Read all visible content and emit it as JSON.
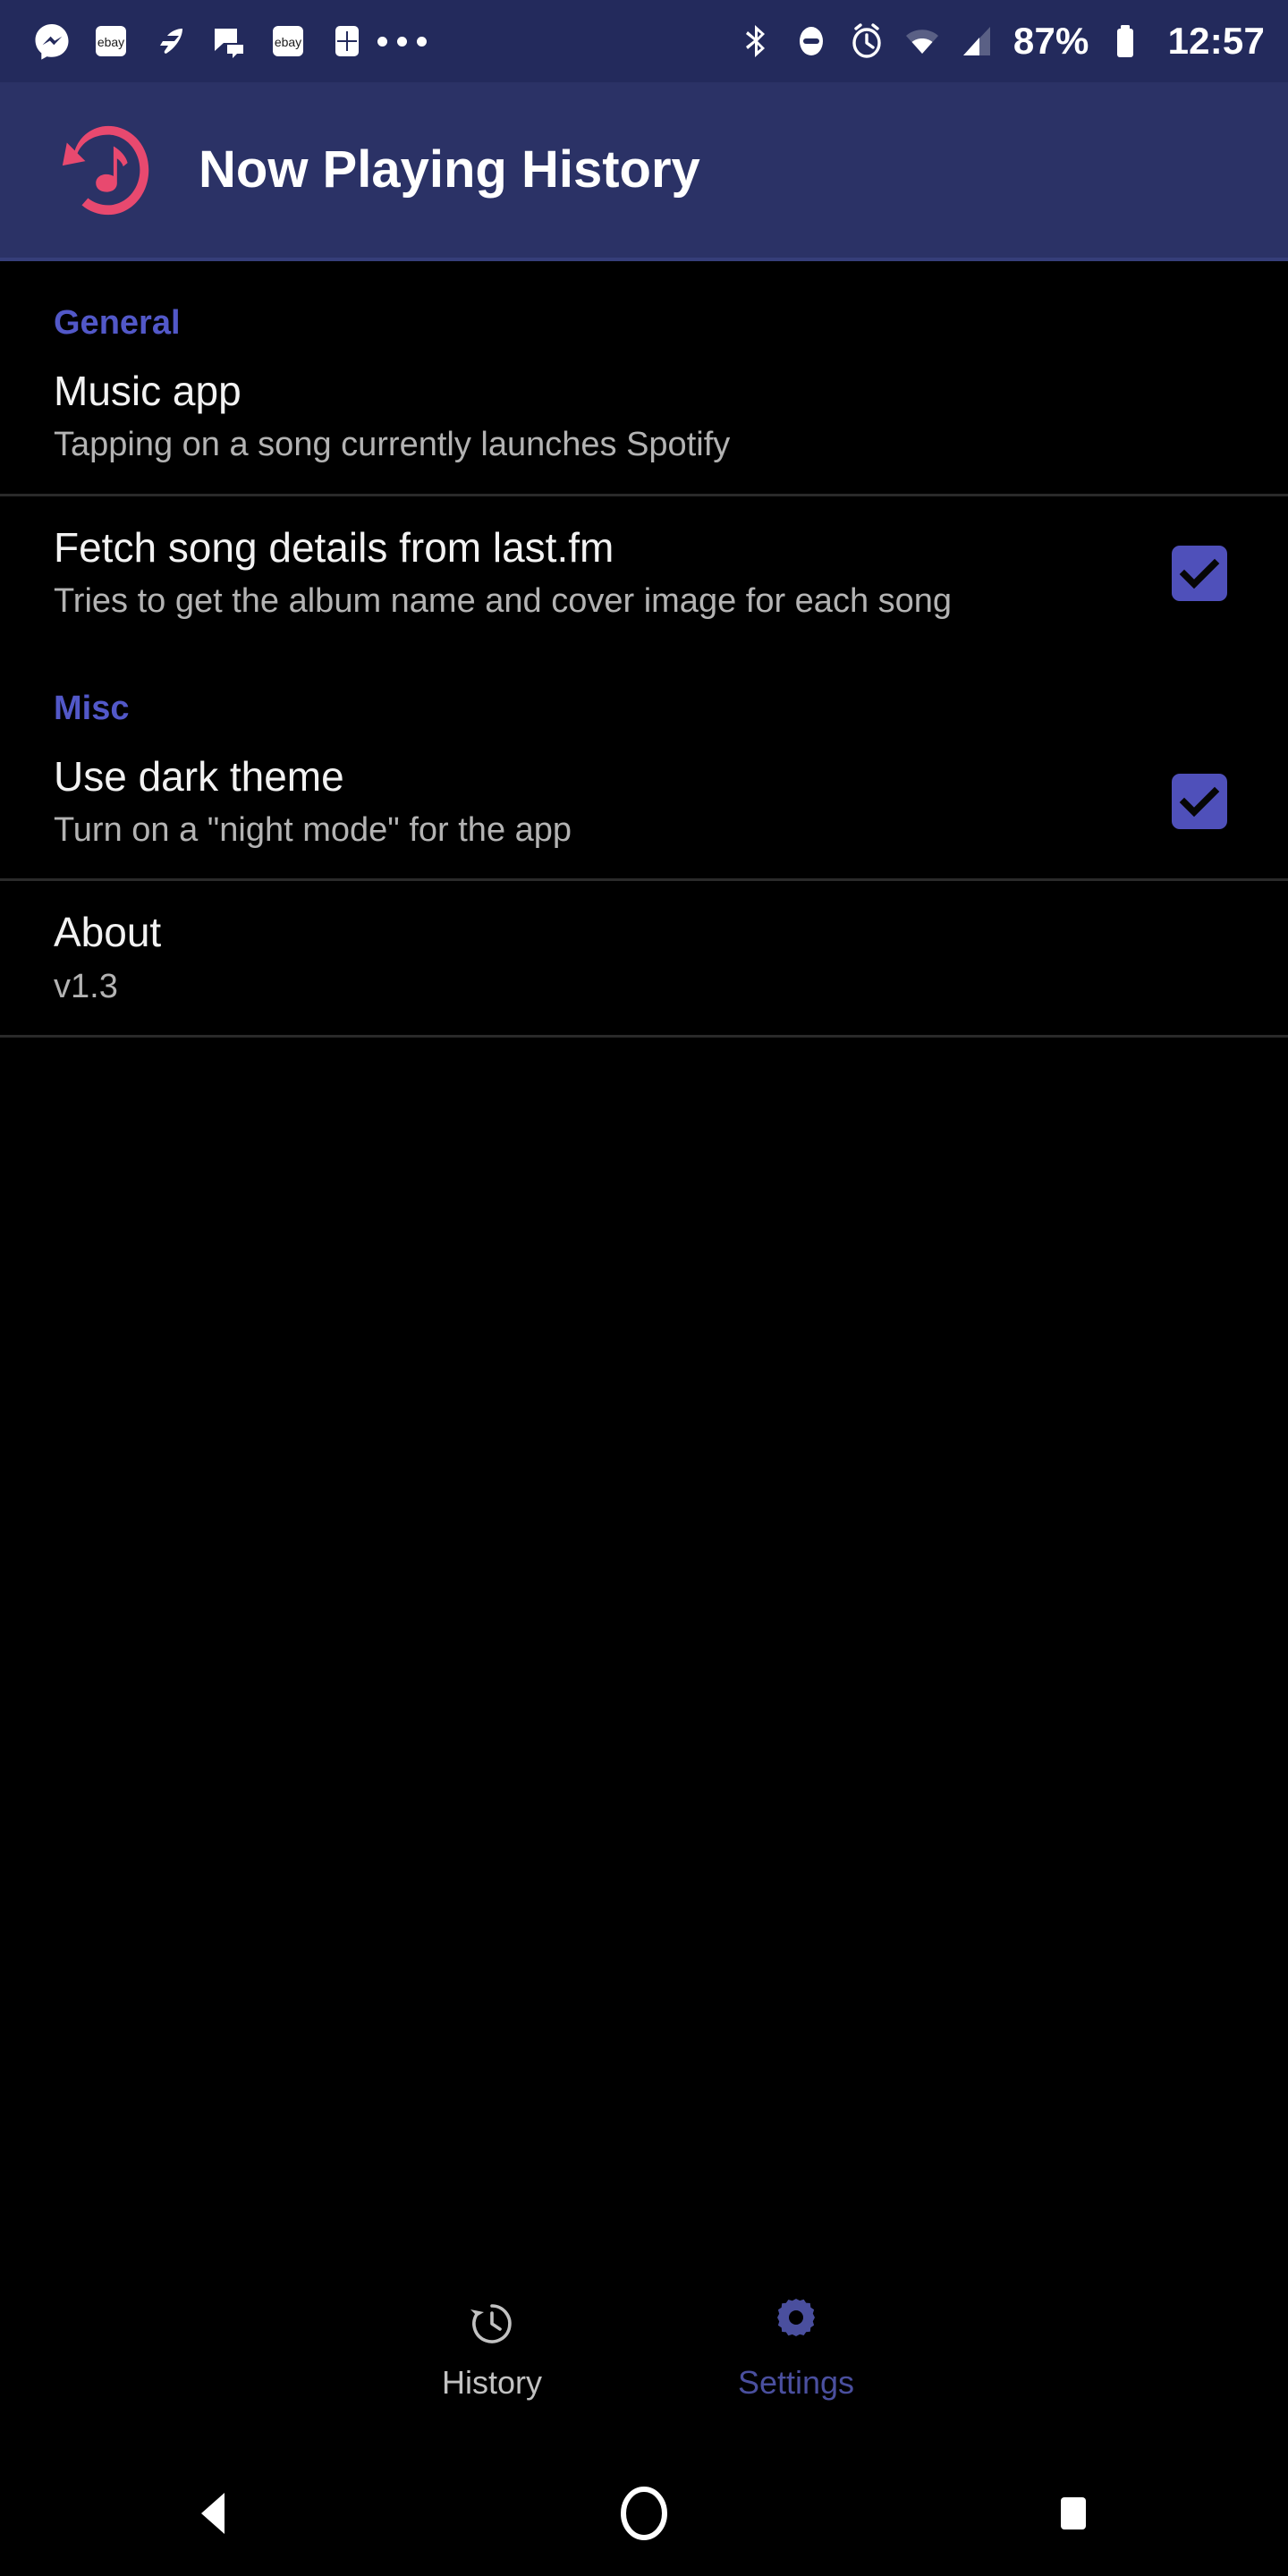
{
  "status_bar": {
    "notification_icons": [
      {
        "name": "messenger-icon",
        "label": "Messenger"
      },
      {
        "name": "ebay-icon",
        "label": "ebay"
      },
      {
        "name": "wing-icon",
        "label": "Wing"
      },
      {
        "name": "chat-bubble-icon",
        "label": "Chat"
      },
      {
        "name": "ebay-icon-2",
        "label": "ebay"
      },
      {
        "name": "plus-box-icon",
        "label": "Plus"
      }
    ],
    "overflow_indicator": "•••",
    "system_icons": [
      {
        "name": "bluetooth-icon"
      },
      {
        "name": "do-not-disturb-icon"
      },
      {
        "name": "alarm-icon"
      },
      {
        "name": "wifi-icon"
      },
      {
        "name": "cellular-signal-icon"
      }
    ],
    "battery_percent": "87%",
    "clock": "12:57"
  },
  "app_bar": {
    "title": "Now Playing History",
    "logo_name": "now-playing-history-logo",
    "background_color": "#2b3266",
    "logo_color": "#e8496f"
  },
  "theme": {
    "accent": "#5258c8",
    "checkbox_fill": "#4f50ba",
    "background": "#000000",
    "title_color": "#f2f2f2",
    "summary_color": "#b3b3b3",
    "divider_color": "#2a2a2a",
    "tab_active_color": "#4a4f9e",
    "tab_inactive_color": "#c2c2c2"
  },
  "sections": [
    {
      "header": "General",
      "items": [
        {
          "name": "music-app",
          "title": "Music app",
          "summary": "Tapping on a song currently launches Spotify",
          "has_checkbox": false,
          "checked": false
        },
        {
          "name": "fetch-song-details",
          "title": "Fetch song details from last.fm",
          "summary": "Tries to get the album name and cover image for each song",
          "has_checkbox": true,
          "checked": true
        }
      ]
    },
    {
      "header": "Misc",
      "items": [
        {
          "name": "use-dark-theme",
          "title": "Use dark theme",
          "summary": "Turn on a \"night mode\" for the app",
          "has_checkbox": true,
          "checked": true
        },
        {
          "name": "about",
          "title": "About",
          "summary": "v1.3",
          "has_checkbox": false,
          "checked": false
        }
      ]
    }
  ],
  "bottom_tabs": [
    {
      "name": "tab-history",
      "label": "History",
      "icon": "history-icon",
      "active": false
    },
    {
      "name": "tab-settings",
      "label": "Settings",
      "icon": "gear-icon",
      "active": true
    }
  ],
  "nav_bar": {
    "back": "back-icon",
    "home": "home-icon",
    "recents": "recents-icon"
  }
}
